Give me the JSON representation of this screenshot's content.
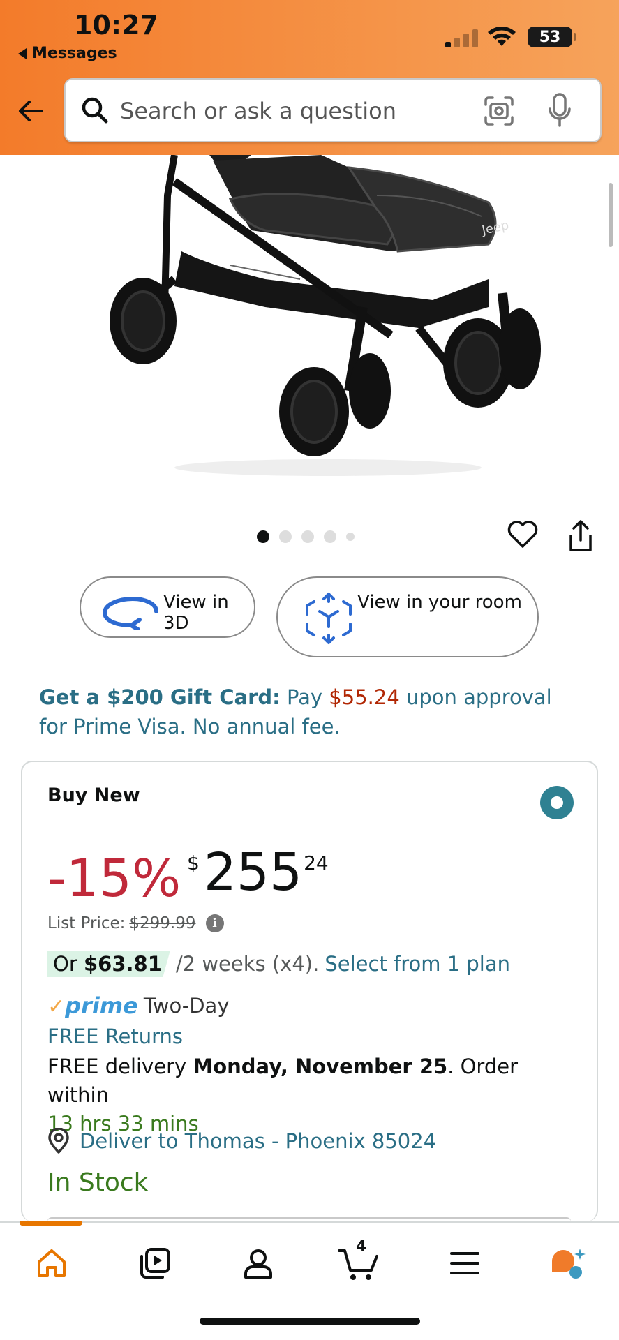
{
  "status_bar": {
    "time": "10:27",
    "back_app": "Messages",
    "battery": "53"
  },
  "search": {
    "placeholder": "Search or ask a question"
  },
  "gallery": {
    "dot_count": 5,
    "active_index": 0,
    "brand_on_product": "Jeep"
  },
  "view_buttons": {
    "view_3d": "View in 3D",
    "view_room": "View in your room"
  },
  "promo": {
    "bold": "Get a $200 Gift Card:",
    "pay": "Pay",
    "amount": "$55.24",
    "rest": "upon approval for Prime Visa. No annual fee."
  },
  "buy_box": {
    "title": "Buy New",
    "discount": "-15%",
    "currency": "$",
    "price_whole": "255",
    "price_fraction": "24",
    "list_price_label": "List Price:",
    "list_price": "$299.99",
    "installment_prefix": "Or",
    "installment_amount": "$63.81",
    "installment_terms": "/2 weeks (x4).",
    "installment_link": "Select from 1 plan",
    "prime_check": "✓",
    "prime_word": "prime",
    "prime_speed": "Two-Day",
    "free_returns": "FREE Returns",
    "delivery_prefix": "FREE delivery",
    "delivery_date": "Monday, November 25",
    "delivery_suffix": ". Order within",
    "countdown": "13 hrs 33 mins",
    "deliver_to": "Deliver to Thomas - Phoenix 85024",
    "stock": "In Stock"
  },
  "tabbar": {
    "cart_count": "4",
    "active_tab": "home"
  },
  "colors": {
    "header_start": "#f37b2a",
    "header_end": "#f6a35b",
    "link_teal": "#2a6e85",
    "discount_red": "#c0293a",
    "price_red": "#b12704",
    "stock_green": "#3a7a1e",
    "active_tab_orange": "#e77600"
  }
}
